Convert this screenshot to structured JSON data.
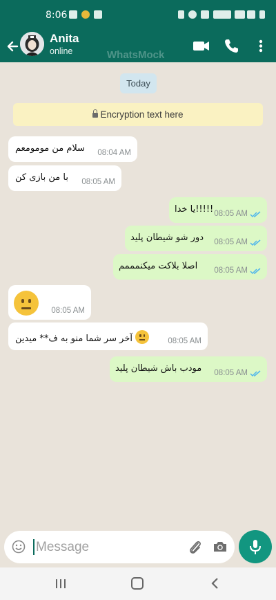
{
  "status_bar": {
    "time": "8:06"
  },
  "header": {
    "contact_name": "Anita",
    "contact_status": "online",
    "watermark": "WhatsMock"
  },
  "chat": {
    "date_chip": "Today",
    "encryption_notice": "Encryption text here",
    "messages": [
      {
        "direction": "incoming",
        "text": "سلام من مومومعم",
        "time": "08:04 AM"
      },
      {
        "direction": "incoming",
        "text": "با من بازی کن",
        "time": "08:05 AM"
      },
      {
        "direction": "outgoing",
        "text": "یا خدا!!!!!",
        "time": "08:05 AM",
        "read": true
      },
      {
        "direction": "outgoing",
        "text": "دور شو شیطان پلید",
        "time": "08:05 AM",
        "read": true
      },
      {
        "direction": "outgoing",
        "text": "اصلا بلاکت میکنمممم",
        "time": "08:05 AM",
        "read": true
      },
      {
        "direction": "incoming",
        "emoji": "neutral-face",
        "time": "08:05 AM"
      },
      {
        "direction": "incoming",
        "text": "آخر سر شما منو به ف** میدین",
        "emoji": "neutral-face",
        "time": "08:05 AM"
      },
      {
        "direction": "outgoing",
        "text": "مودب باش شیطان پلید",
        "time": "08:05 AM",
        "read": true
      }
    ]
  },
  "composer": {
    "placeholder": "Message"
  },
  "colors": {
    "header": "#0b6b5c",
    "outgoing_bubble": "#dcf8c6",
    "incoming_bubble": "#ffffff",
    "read_ticks": "#4fb6ec",
    "mic_button": "#129680",
    "chat_background": "#e9e3da",
    "encryption_banner": "#faf2c2",
    "date_chip": "#d2e6ef"
  },
  "icons": {
    "back": "arrow-left-icon",
    "video_call": "video-camera-icon",
    "voice_call": "phone-icon",
    "menu": "more-vertical-icon",
    "emoji": "smiley-icon",
    "attach": "paperclip-icon",
    "camera": "camera-icon",
    "mic": "microphone-icon"
  }
}
